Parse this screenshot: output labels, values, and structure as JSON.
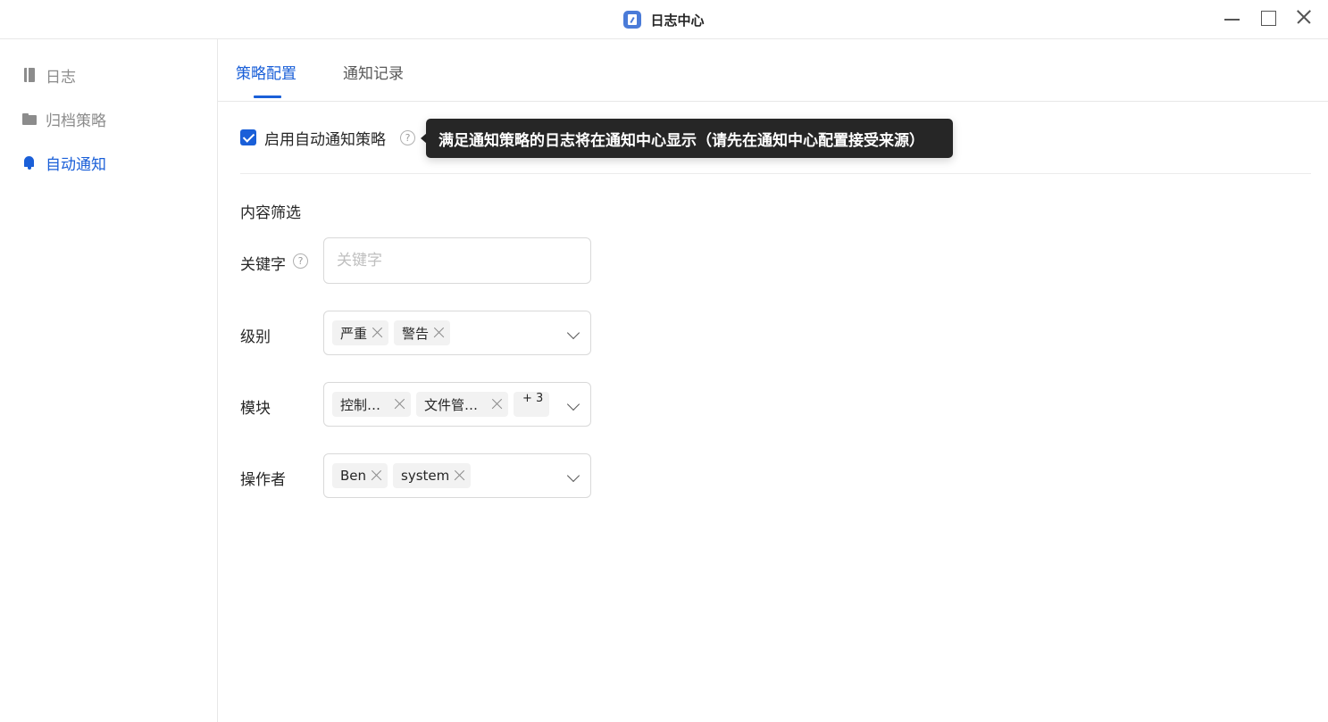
{
  "window": {
    "title": "日志中心",
    "icon": "app-log-icon"
  },
  "sidebar": {
    "items": [
      {
        "label": "日志",
        "icon": "book-icon",
        "active": false
      },
      {
        "label": "归档策略",
        "icon": "folder-icon",
        "active": false
      },
      {
        "label": "自动通知",
        "icon": "bell-icon",
        "active": true
      }
    ]
  },
  "tabs": [
    {
      "label": "策略配置",
      "active": true
    },
    {
      "label": "通知记录",
      "active": false
    }
  ],
  "enable": {
    "label": "启用自动通知策略",
    "checked": true,
    "help": "?",
    "tooltip": "满足通知策略的日志将在通知中心显示（请先在通知中心配置接受来源）"
  },
  "filter": {
    "title": "内容筛选",
    "keyword": {
      "label": "关键字",
      "help": "?",
      "value": "",
      "placeholder": "关键字"
    },
    "level": {
      "label": "级别",
      "tags": [
        "严重",
        "警告"
      ]
    },
    "module": {
      "label": "模块",
      "tags": [
        "控制…",
        "文件管…"
      ],
      "more": "+ 3"
    },
    "operator": {
      "label": "操作者",
      "tags": [
        "Ben",
        "system"
      ]
    }
  },
  "colors": {
    "accent": "#1a5fd8",
    "tooltip_bg": "#262626",
    "border": "#d9d9d9",
    "tag_bg": "#f2f2f2"
  }
}
